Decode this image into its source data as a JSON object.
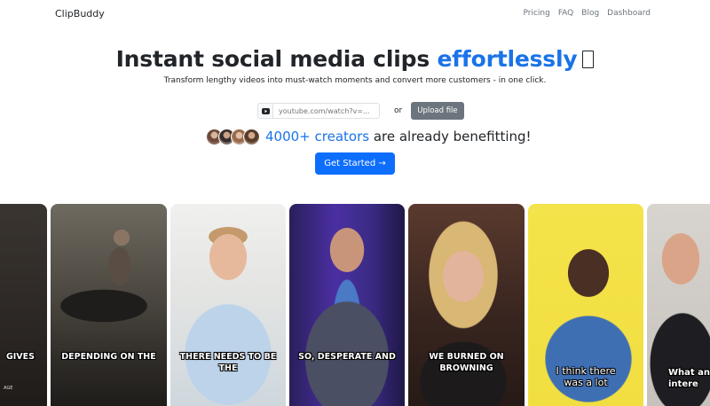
{
  "nav": {
    "brand": "ClipBuddy",
    "links": [
      "Pricing",
      "FAQ",
      "Blog",
      "Dashboard"
    ]
  },
  "hero": {
    "title_main": "Instant social media clips ",
    "title_accent": "effortlessly",
    "subtitle": "Transform lengthy videos into must-watch moments and convert more customers - in one click."
  },
  "input": {
    "icon": "youtube-icon",
    "placeholder": "youtube.com/watch?v=...",
    "or": "or",
    "upload_label": "Upload file"
  },
  "creators": {
    "count": "4000+ creators",
    "rest": " are already benefitting!"
  },
  "cta": {
    "label": "Get Started →"
  },
  "clips": [
    {
      "caption": "GIVES",
      "caption_small": "AGE"
    },
    {
      "caption": "DEPENDING ON THE"
    },
    {
      "caption": "THERE NEEDS TO BE THE"
    },
    {
      "caption": "SO, DESPERATE AND"
    },
    {
      "caption": "WE BURNED ON BROWNING"
    },
    {
      "caption": "I think there was a lot"
    },
    {
      "caption": "What an intere"
    }
  ],
  "colors": {
    "accent": "#1a73e8",
    "primary_button": "#0d6efd",
    "secondary_button": "#6c757d"
  }
}
